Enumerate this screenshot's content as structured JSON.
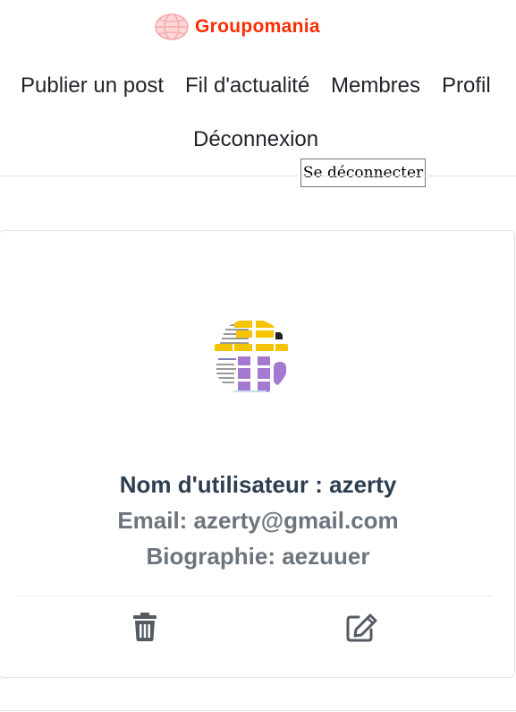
{
  "brand": {
    "name": "Groupomania",
    "logo_icon": "globe-icon",
    "color": "#fd2d01"
  },
  "nav": {
    "items": [
      {
        "label": "Publier un post"
      },
      {
        "label": "Fil d'actualité"
      },
      {
        "label": "Membres"
      },
      {
        "label": "Profil"
      },
      {
        "label": "Déconnexion"
      }
    ]
  },
  "tooltip": {
    "text": "Se déconnecter"
  },
  "profile": {
    "avatar_icon": "profile-avatar-image",
    "username_text": "Nom d'utilisateur : azerty",
    "email_text": "Email: azerty@gmail.com",
    "bio_text": "Biographie: aezuuer",
    "actions": [
      {
        "icon": "trash-icon"
      },
      {
        "icon": "edit-icon"
      }
    ]
  },
  "colors": {
    "text_dark": "#2c3e50",
    "text_muted": "#6c757d",
    "icon": "#555b62",
    "border": "#dee2e6"
  }
}
